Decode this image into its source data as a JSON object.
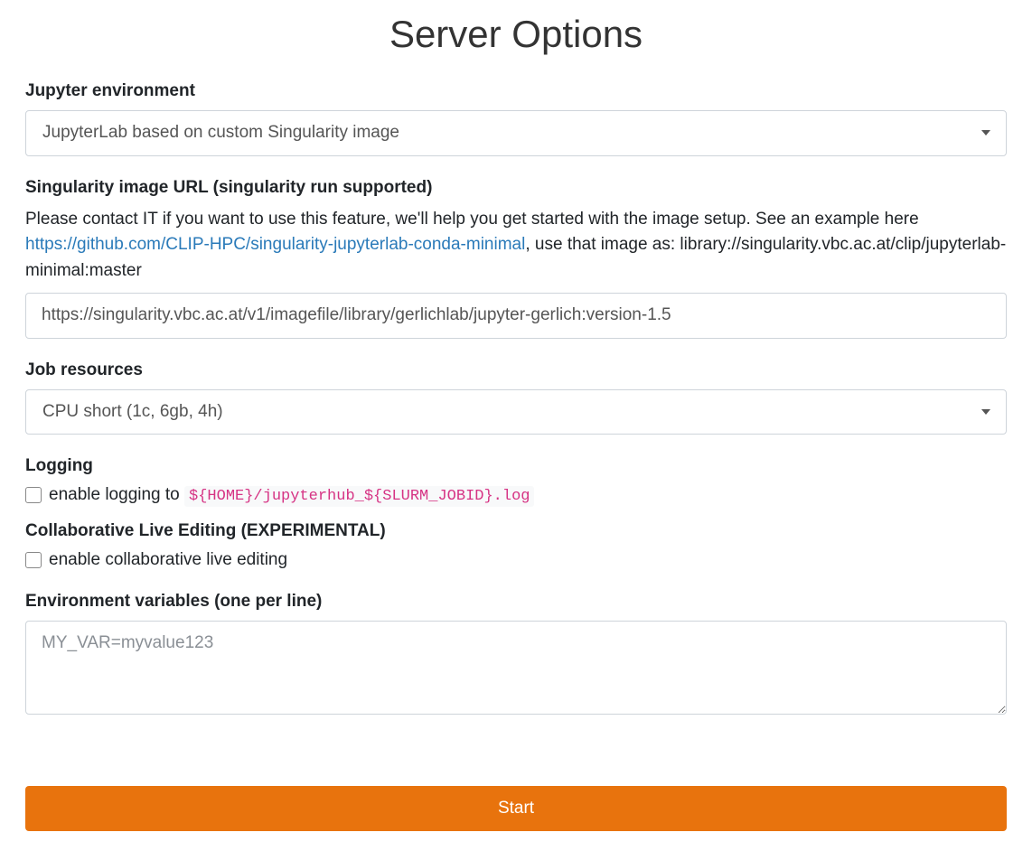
{
  "page": {
    "title": "Server Options"
  },
  "form": {
    "jupyter_env": {
      "label": "Jupyter environment",
      "value": "JupyterLab based on custom Singularity image"
    },
    "singularity_url": {
      "label": "Singularity image URL (singularity run supported)",
      "help_prefix": "Please contact IT if you want to use this feature, we'll help you get started with the image setup. See an example here ",
      "help_link_text": "https://github.com/CLIP-HPC/singularity-jupyterlab-conda-minimal",
      "help_suffix": ", use that image as: library://singularity.vbc.ac.at/clip/jupyterlab-minimal:master",
      "value": "https://singularity.vbc.ac.at/v1/imagefile/library/gerlichlab/jupyter-gerlich:version-1.5"
    },
    "job_resources": {
      "label": "Job resources",
      "value": "CPU short (1c, 6gb, 4h)"
    },
    "logging": {
      "label": "Logging",
      "checkbox_label": "enable logging to ",
      "code": "${HOME}/jupyterhub_${SLURM_JOBID}.log"
    },
    "collab": {
      "label": "Collaborative Live Editing (EXPERIMENTAL)",
      "checkbox_label": "enable collaborative live editing"
    },
    "env_vars": {
      "label": "Environment variables (one per line)",
      "placeholder": "MY_VAR=myvalue123"
    },
    "submit": {
      "label": "Start"
    }
  }
}
